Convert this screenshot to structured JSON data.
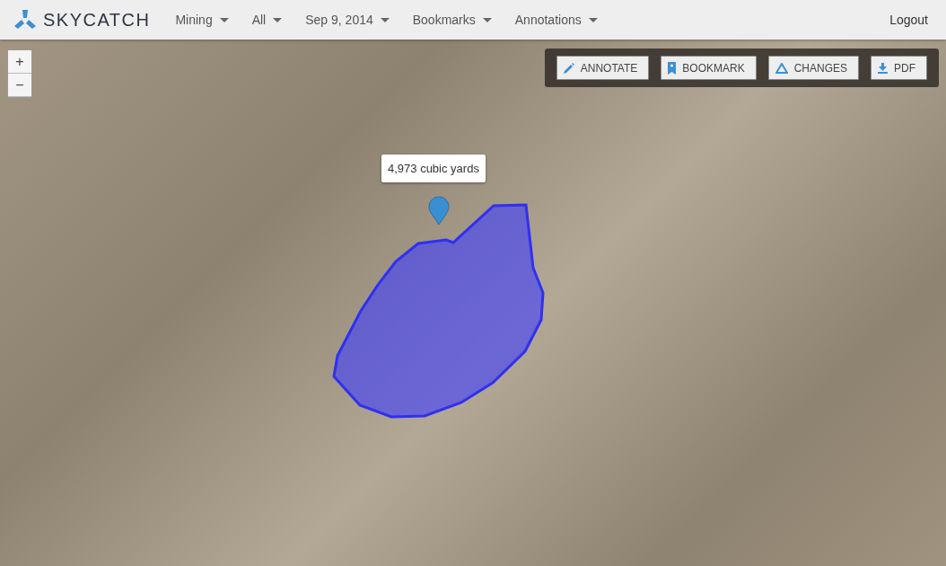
{
  "brand": {
    "name": "SKYCATCH"
  },
  "menus": [
    {
      "label": "Mining"
    },
    {
      "label": "All"
    },
    {
      "label": "Sep 9, 2014"
    },
    {
      "label": "Bookmarks"
    },
    {
      "label": "Annotations"
    }
  ],
  "logout": "Logout",
  "zoom": {
    "in": "+",
    "out": "−"
  },
  "toolbar": [
    {
      "kind": "pencil",
      "label": "ANNOTATE"
    },
    {
      "kind": "bookmark",
      "label": "BOOKMARK"
    },
    {
      "kind": "triangle",
      "label": "CHANGES"
    },
    {
      "kind": "download",
      "label": "PDF"
    }
  ],
  "measurement": {
    "label": "4,973 cubic yards"
  }
}
